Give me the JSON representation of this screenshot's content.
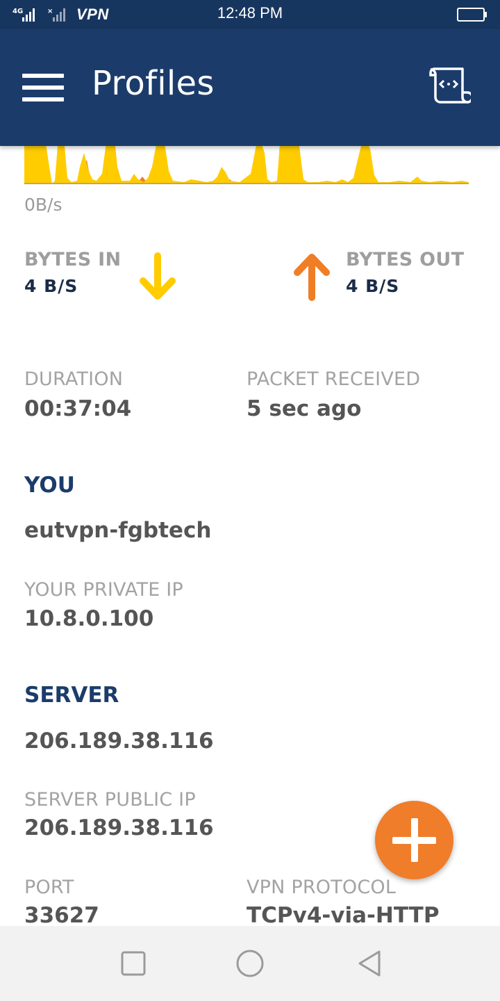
{
  "status_bar": {
    "network": "4G",
    "vpn_label": "VPN",
    "time": "12:48 PM",
    "icons": [
      "signal-icon",
      "no-signal-icon",
      "battery-icon"
    ]
  },
  "app_bar": {
    "title": "Profiles",
    "icons": [
      "menu-icon",
      "script-icon"
    ]
  },
  "graph": {
    "unit_label": "0B/s",
    "colors": {
      "bytes_in": "#ffcc00",
      "bytes_out": "#f07e26"
    }
  },
  "bytes_in": {
    "label": "BYTES IN",
    "value": "4 B/S",
    "icon": "arrow-down-icon",
    "color": "#ffcc00"
  },
  "bytes_out": {
    "label": "BYTES OUT",
    "value": "4 B/S",
    "icon": "arrow-up-icon",
    "color": "#f07e26"
  },
  "duration": {
    "label": "DURATION",
    "value": "00:37:04"
  },
  "packet_received": {
    "label": "PACKET RECEIVED",
    "value": "5 sec ago"
  },
  "you": {
    "heading": "YOU",
    "name": "eutvpn-fgbtech",
    "private_ip_label": "YOUR PRIVATE IP",
    "private_ip": "10.8.0.100"
  },
  "server": {
    "heading": "SERVER",
    "address": "206.189.38.116",
    "public_ip_label": "SERVER PUBLIC IP",
    "public_ip": "206.189.38.116",
    "port_label": "PORT",
    "port": "33627",
    "protocol_label": "VPN PROTOCOL",
    "protocol": "TCPv4-via-HTTP"
  },
  "fab": {
    "icon": "plus-icon",
    "color": "#ef7d2a"
  },
  "nav_bar": {
    "icons": [
      "recents-icon",
      "home-icon",
      "back-icon"
    ]
  },
  "theme": {
    "primary": "#1b3c6b",
    "status_bar": "#17365f",
    "accent": "#ef7d2a"
  }
}
